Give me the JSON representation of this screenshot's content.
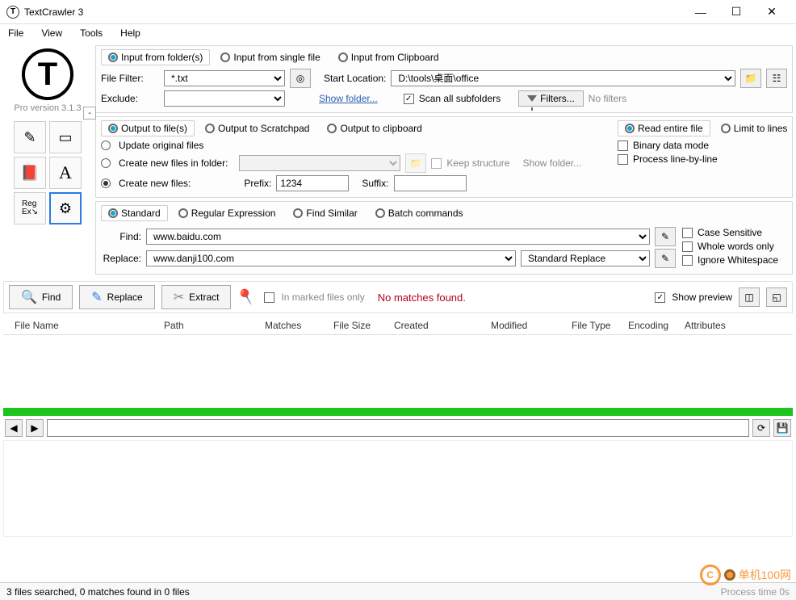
{
  "window": {
    "title": "TextCrawler 3"
  },
  "menu": {
    "file": "File",
    "view": "View",
    "tools": "Tools",
    "help": "Help"
  },
  "version": "Pro version 3.1.3",
  "input": {
    "tab_folder": "Input from folder(s)",
    "tab_single": "Input from single file",
    "tab_clipboard": "Input from Clipboard",
    "file_filter_label": "File Filter:",
    "file_filter_value": "*.txt",
    "start_location_label": "Start Location:",
    "start_location_value": "D:\\tools\\桌面\\office",
    "exclude_label": "Exclude:",
    "exclude_value": "",
    "show_folder": "Show folder...",
    "scan_subfolders": "Scan all subfolders",
    "filters_btn": "Filters...",
    "no_filters": "No filters"
  },
  "output": {
    "tab_files": "Output to file(s)",
    "tab_scratch": "Output to Scratchpad",
    "tab_clip": "Output to clipboard",
    "opt_update": "Update original files",
    "opt_create_folder": "Create new files in folder:",
    "opt_create_new": "Create new files:",
    "keep_structure": "Keep structure",
    "show_folder": "Show folder...",
    "prefix_label": "Prefix:",
    "prefix_value": "1234",
    "suffix_label": "Suffix:",
    "suffix_value": "",
    "read_entire": "Read entire file",
    "limit_lines": "Limit to lines",
    "binary_mode": "Binary data mode",
    "process_line": "Process line-by-line"
  },
  "search": {
    "tab_standard": "Standard",
    "tab_regex": "Regular Expression",
    "tab_similar": "Find Similar",
    "tab_batch": "Batch commands",
    "find_label": "Find:",
    "find_value": "www.baidu.com",
    "replace_label": "Replace:",
    "replace_value": "www.danji100.com",
    "replace_mode": "Standard Replace",
    "case_sensitive": "Case Sensitive",
    "whole_words": "Whole words only",
    "ignore_ws": "Ignore Whitespace"
  },
  "actions": {
    "find": "Find",
    "replace": "Replace",
    "extract": "Extract",
    "marked_only": "In marked files only",
    "no_matches": "No matches found.",
    "show_preview": "Show preview"
  },
  "columns": {
    "filename": "File Name",
    "path": "Path",
    "matches": "Matches",
    "filesize": "File Size",
    "created": "Created",
    "modified": "Modified",
    "filetype": "File Type",
    "encoding": "Encoding",
    "attributes": "Attributes"
  },
  "status": {
    "left": "3 files searched, 0 matches found in 0 files",
    "right": "Process time 0s"
  },
  "watermark": {
    "text": "单机100网"
  }
}
